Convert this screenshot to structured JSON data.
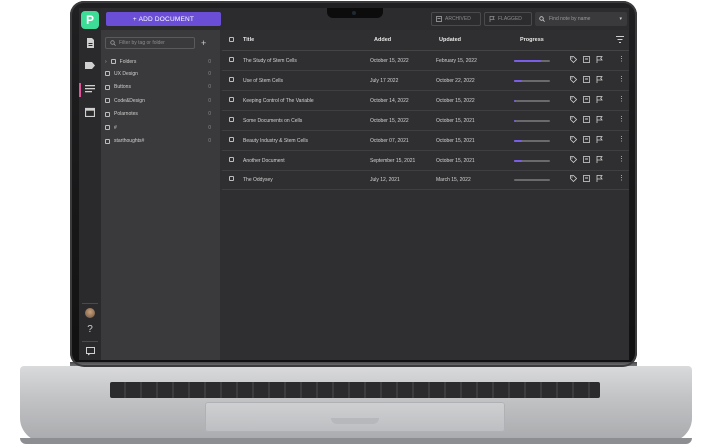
{
  "toolbar": {
    "add_document": "+ ADD DOCUMENT",
    "archived": "ARCHIVED",
    "flagged": "FLAGGED",
    "search_placeholder": "Find note by name"
  },
  "sidebar": {
    "filter_placeholder": "Filter by tag or folder",
    "folders_label": "Folders",
    "folders_count": "0",
    "tags": [
      {
        "label": "UX Design",
        "count": "0"
      },
      {
        "label": "Buttons",
        "count": "0"
      },
      {
        "label": "Code&Design",
        "count": "0"
      },
      {
        "label": "Polarnotes",
        "count": "0"
      },
      {
        "label": "#",
        "count": "0"
      },
      {
        "label": "starthoughts#",
        "count": "0"
      }
    ]
  },
  "table": {
    "headers": {
      "title": "Title",
      "added": "Added",
      "updated": "Updated",
      "progress": "Progress"
    },
    "rows": [
      {
        "title": "The Study of Stem Cells",
        "added": "October 15, 2022",
        "updated": "February 15, 2022",
        "progress": 0.75
      },
      {
        "title": "Use of Stem Cells",
        "added": "July 17 2022",
        "updated": "October 22, 2022",
        "progress": 0.22
      },
      {
        "title": "Keeping Control of The Variable",
        "added": "October 14, 2022",
        "updated": "October 15, 2022",
        "progress": 0.05
      },
      {
        "title": "Some Documents on Cells",
        "added": "October 15, 2022",
        "updated": "October 15, 2021",
        "progress": 0.05
      },
      {
        "title": "Beauty Industry & Stem Cells",
        "added": "October 07, 2021",
        "updated": "October 15, 2021",
        "progress": 0.22
      },
      {
        "title": "Another Document",
        "added": "September 15, 2021",
        "updated": "October 15, 2021",
        "progress": 0.22
      },
      {
        "title": "The Oddysey",
        "added": "July 12, 2021",
        "updated": "March 15, 2022",
        "progress": 0.0
      }
    ]
  },
  "colors": {
    "accent": "#6a4fd6",
    "logo": "#3ddc97",
    "progress": "#7b5ee8"
  }
}
